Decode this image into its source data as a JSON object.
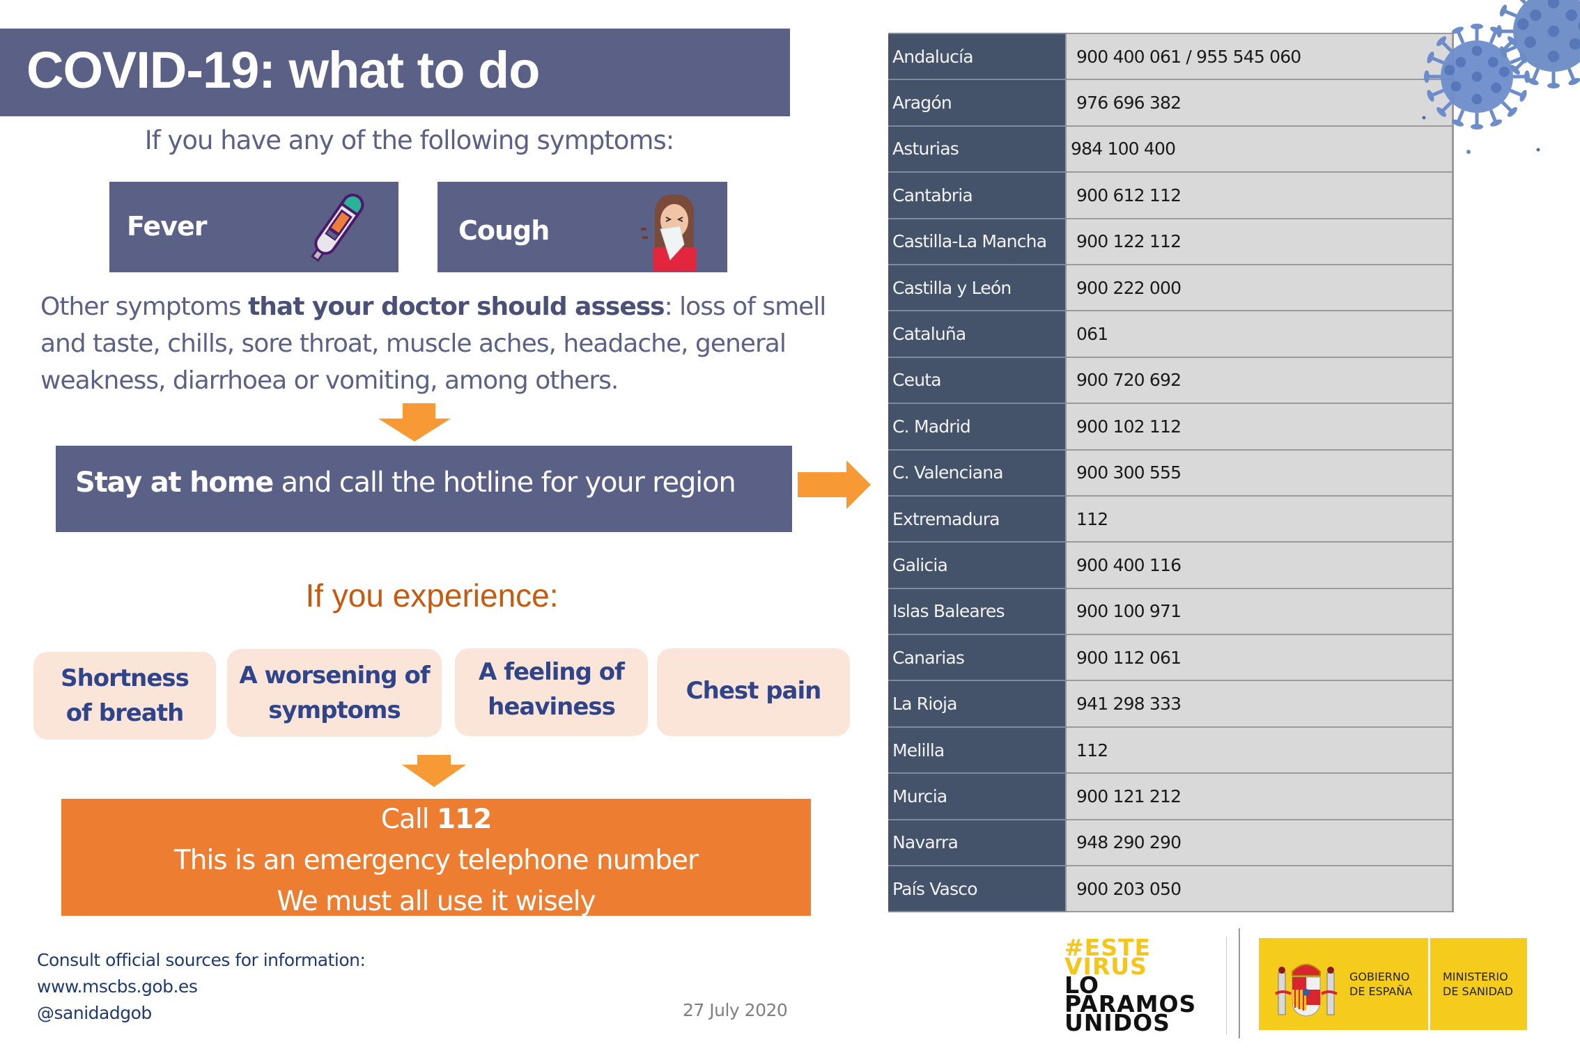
{
  "title": "COVID-19: what to do",
  "symptoms_intro": "If you have any of the following symptoms:",
  "main_symptoms": [
    {
      "label": "Fever",
      "icon": "thermometer-icon"
    },
    {
      "label": "Cough",
      "icon": "sneezing-person-icon"
    }
  ],
  "other_symptoms": {
    "prefix": "Other symptoms ",
    "emphasis": "that your doctor should assess",
    "suffix": ": loss of smell and taste, chills, sore throat, muscle aches, headache, general weakness, diarrhoea or vomiting, among others."
  },
  "stay_home": {
    "emphasis": "Stay at home",
    "rest": " and call the hotline for your region"
  },
  "experience_heading": "If you experience:",
  "warning_symptoms": [
    {
      "line1": "Shortness",
      "line2": "of breath"
    },
    {
      "line1": "A worsening of",
      "line2": "symptoms"
    },
    {
      "line1": "A feeling of",
      "line2": "heaviness"
    },
    {
      "line1": "Chest pain",
      "line2": ""
    }
  ],
  "emergency": {
    "call_prefix": "Call ",
    "number": "112",
    "line2": "This is an emergency telephone number",
    "line3": "We must all use it wisely"
  },
  "sources": {
    "heading": "Consult official sources for information:",
    "website": "www.mscbs.gob.es",
    "twitter": "@sanidadgob"
  },
  "date": "27 July 2020",
  "hotlines": [
    {
      "region": "Andalucía",
      "phone": "900 400 061 / 955 545 060"
    },
    {
      "region": "Aragón",
      "phone": "976 696 382"
    },
    {
      "region": "Asturias",
      "phone": "984 100 400"
    },
    {
      "region": "Cantabria",
      "phone": "900 612 112"
    },
    {
      "region": "Castilla-La Mancha",
      "phone": "900 122 112"
    },
    {
      "region": "Castilla y León",
      "phone": "900 222 000"
    },
    {
      "region": "Cataluña",
      "phone": "061"
    },
    {
      "region": "Ceuta",
      "phone": "900 720 692"
    },
    {
      "region": "C. Madrid",
      "phone": "900 102 112"
    },
    {
      "region": "C. Valenciana",
      "phone": "900 300 555"
    },
    {
      "region": "Extremadura",
      "phone": "112"
    },
    {
      "region": "Galicia",
      "phone": "900 400 116"
    },
    {
      "region": "Islas Baleares",
      "phone": "900 100 971"
    },
    {
      "region": "Canarias",
      "phone": "900 112 061"
    },
    {
      "region": "La Rioja",
      "phone": "941 298 333"
    },
    {
      "region": "Melilla",
      "phone": "112"
    },
    {
      "region": "Murcia",
      "phone": "900 121 212"
    },
    {
      "region": "Navarra",
      "phone": "948 290 290"
    },
    {
      "region": "País Vasco",
      "phone": "900 203 050"
    }
  ],
  "logos": {
    "campaign": {
      "line1": "#ESTE",
      "line2": "VIRUS",
      "line3": "LO",
      "line4": "PARAMOS",
      "line5": "UNIDOS"
    },
    "government": {
      "line1": "GOBIERNO",
      "line2": "DE ESPAÑA"
    },
    "ministry": {
      "line1": "MINISTERIO",
      "line2": "DE SANIDAD"
    }
  },
  "colors": {
    "banner": "#5b6186",
    "accent_orange": "#ed7d31",
    "arrow_orange": "#f79a35",
    "warning_box": "#fbe5d8",
    "table_region": "#445369",
    "table_phone": "#d9d9d9",
    "gov_yellow": "#f6cc1c"
  }
}
